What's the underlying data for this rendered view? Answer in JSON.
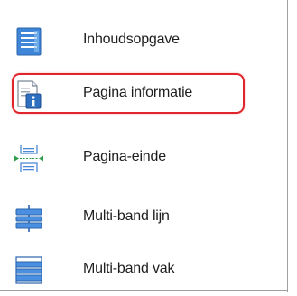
{
  "menu": {
    "items": [
      {
        "label": "Inhoudsopgave",
        "icon": "table-of-contents-icon"
      },
      {
        "label": "Pagina informatie",
        "icon": "page-info-icon",
        "highlighted": true
      },
      {
        "label": "Pagina-einde",
        "icon": "page-break-icon"
      },
      {
        "label": "Multi-band lijn",
        "icon": "multi-band-line-icon"
      },
      {
        "label": "Multi-band vak",
        "icon": "multi-band-box-icon"
      }
    ]
  },
  "colors": {
    "highlight": "#e0242b",
    "icon_blue": "#3c7fd1",
    "icon_green": "#2e9b4a"
  }
}
